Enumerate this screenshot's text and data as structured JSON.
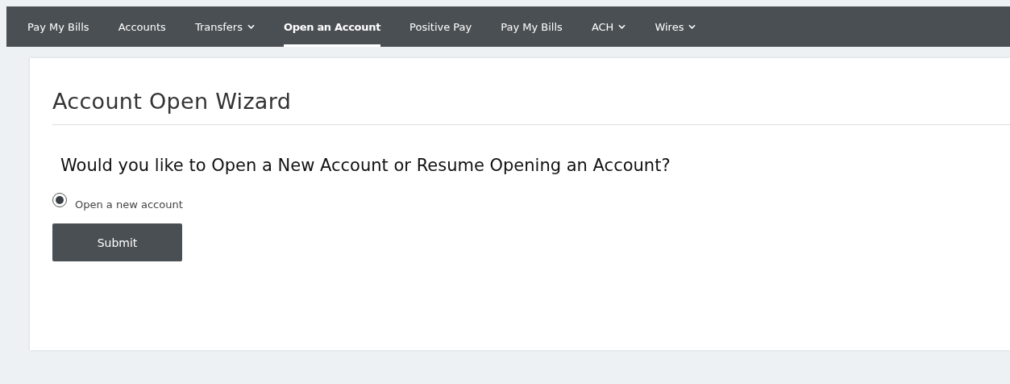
{
  "nav": [
    {
      "label": "Pay My Bills",
      "selected": false,
      "dropdown": false
    },
    {
      "label": "Accounts",
      "selected": false,
      "dropdown": false
    },
    {
      "label": "Transfers",
      "selected": false,
      "dropdown": true
    },
    {
      "label": "Open an Account",
      "selected": true,
      "dropdown": false
    },
    {
      "label": "Positive Pay",
      "selected": false,
      "dropdown": false
    },
    {
      "label": "Pay My Bills",
      "selected": false,
      "dropdown": false
    },
    {
      "label": "ACH",
      "selected": false,
      "dropdown": true
    },
    {
      "label": "Wires",
      "selected": false,
      "dropdown": true
    }
  ],
  "card": {
    "title": "Account Open Wizard",
    "question": "Would you like to Open a New Account or Resume Opening an Account?",
    "options": [
      {
        "label": "Open a new account",
        "selected": true
      }
    ],
    "button": "Submit"
  }
}
